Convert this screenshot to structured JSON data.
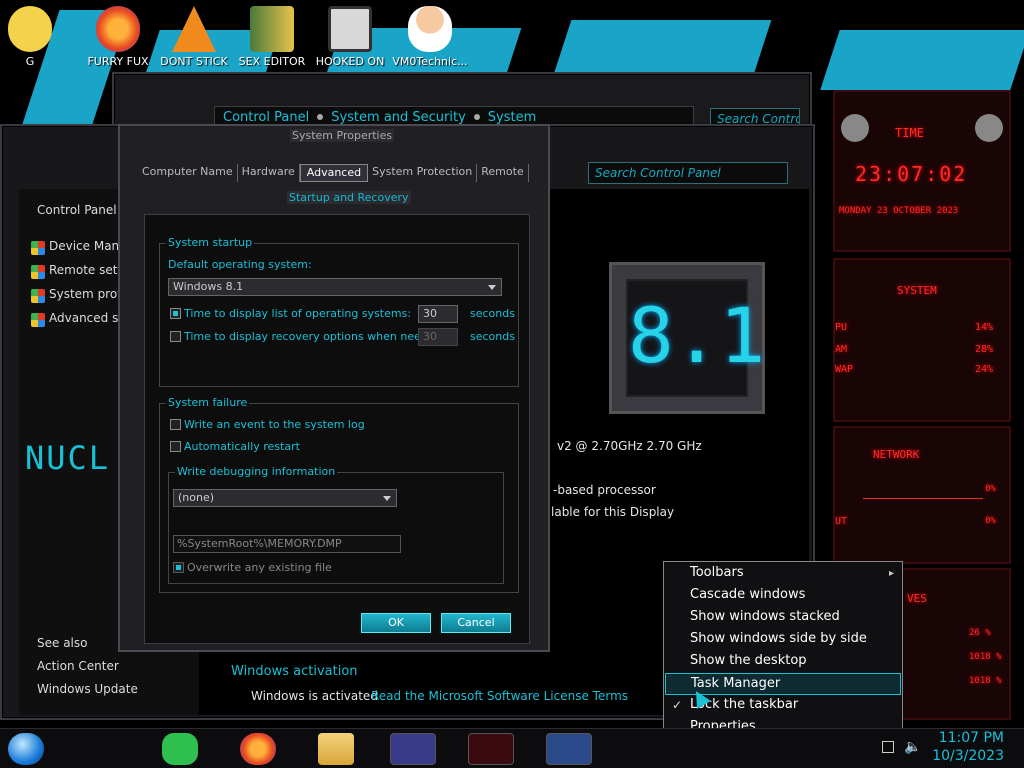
{
  "desktop_icons": [
    {
      "label": "G"
    },
    {
      "label": "FURRY FUX"
    },
    {
      "label": "DONT STICK"
    },
    {
      "label": "SEX EDITOR"
    },
    {
      "label": "HOOKED ON"
    },
    {
      "label": "VM0Technic..."
    }
  ],
  "back_window": {
    "crumbs": [
      "Control Panel",
      "System and Security",
      "System"
    ],
    "search_placeholder": "Search Control..."
  },
  "main_window": {
    "search_placeholder": "Search Control Panel",
    "nav_title": "Control Panel",
    "nav_items": [
      "Device Manag",
      "Remote settin",
      "System protec",
      "Advanced syst"
    ],
    "see_also_title": "See also",
    "see_also": [
      "Action Center",
      "Windows Update"
    ],
    "logo_text": "NUCL",
    "processor": "v2 @ 2.70GHz   2.70 GHz",
    "system_type": "-based processor",
    "pen_touch": "lable for this Display",
    "activation_title": "Windows activation",
    "activation_status": "Windows is activated",
    "license_link": "Read the Microsoft Software License Terms",
    "badge": "8.1"
  },
  "sys_props": {
    "title": "System Properties",
    "tabs": [
      "Computer Name",
      "Hardware",
      "Advanced",
      "System Protection",
      "Remote"
    ],
    "active_tab": "Advanced"
  },
  "startup": {
    "title": "Startup and Recovery",
    "system_startup": "System startup",
    "default_os_label": "Default operating system:",
    "default_os": "Windows 8.1",
    "display_list_label": "Time to display list of operating systems:",
    "display_list_value": "30",
    "display_list_checked": true,
    "recovery_label": "Time to display recovery options when needed:",
    "recovery_value": "30",
    "recovery_checked": false,
    "seconds": "seconds",
    "system_failure": "System failure",
    "write_event": "Write an event to the system log",
    "auto_restart": "Automatically restart",
    "debug_info": "Write debugging information",
    "debug_value": "(none)",
    "dump_file": "%SystemRoot%\\MEMORY.DMP",
    "overwrite": "Overwrite any existing file",
    "ok": "OK",
    "cancel": "Cancel"
  },
  "gadgets": {
    "time_title": "TIME",
    "time": "23:07:02",
    "date": "MONDAY 23 OCTOBER 2023",
    "system_title": "SYSTEM",
    "cpu_label": "PU",
    "cpu": "14%",
    "ram_label": "AM",
    "ram": "28%",
    "swap_label": "WAP",
    "swap": "24%",
    "network_title": "NETWORK",
    "net_in": "0%",
    "net_out_label": "UT",
    "net_out": "0%",
    "drives_title": "VES",
    "drives": [
      "26 %",
      "1018 %",
      "1018 %"
    ]
  },
  "context_menu": {
    "items": [
      "Toolbars",
      "Cascade windows",
      "Show windows stacked",
      "Show windows side by side",
      "Show the desktop",
      "Task Manager",
      "Lock the taskbar",
      "Properties"
    ],
    "highlighted": "Task Manager",
    "checked": "Lock the taskbar"
  },
  "taskbar": {
    "time": "11:07 PM",
    "date": "10/3/2023"
  },
  "colors": {
    "accent": "#19c0d6",
    "gadget_red": "#ff2a2a",
    "wallpaper_blue": "#1aa4c8"
  }
}
